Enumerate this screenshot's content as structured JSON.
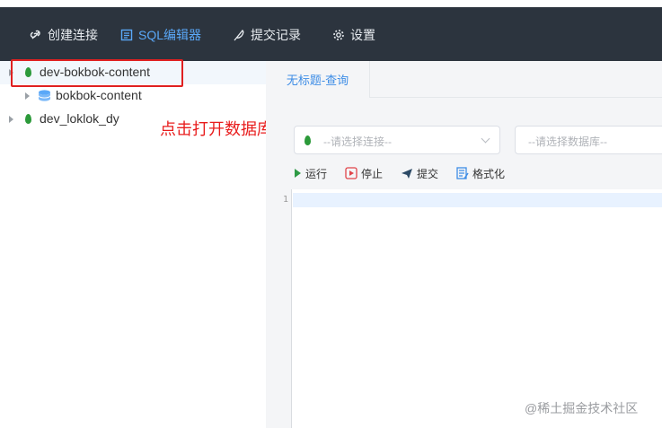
{
  "nav": {
    "items": [
      {
        "label": "创建连接",
        "icon": "link-icon"
      },
      {
        "label": "SQL编辑器",
        "icon": "sql-editor-icon",
        "active": true
      },
      {
        "label": "提交记录",
        "icon": "feather-icon"
      },
      {
        "label": "设置",
        "icon": "gear-icon"
      }
    ]
  },
  "tree": {
    "items": [
      {
        "label": "dev-bokbok-content",
        "icon": "leaf-icon",
        "selected": true
      },
      {
        "label": "bokbok-content",
        "icon": "database-icon"
      },
      {
        "label": "dev_loklok_dy",
        "icon": "leaf-icon"
      }
    ]
  },
  "annotation": "点击打开数据库",
  "tabs": [
    {
      "label": "无标题-查询"
    }
  ],
  "selectors": {
    "connection_placeholder": "--请选择连接--",
    "database_placeholder": "--请选择数据库--"
  },
  "toolbar": {
    "run": "运行",
    "stop": "停止",
    "submit": "提交",
    "format": "格式化"
  },
  "editor": {
    "line_numbers": [
      "1"
    ]
  },
  "watermark": "@稀土掘金技术社区",
  "colors": {
    "topbar": "#2c343e",
    "accent": "#3e8de6",
    "annotation": "#e81c1c"
  }
}
